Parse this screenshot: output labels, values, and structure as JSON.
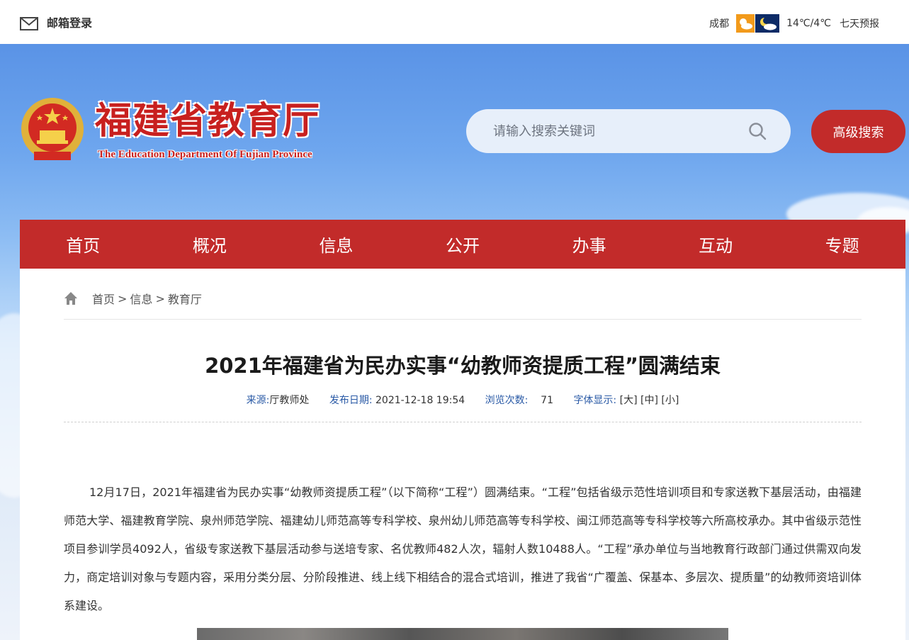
{
  "topbar": {
    "mail_label": "邮箱登录",
    "weather": {
      "city": "成都",
      "temp": "14℃/4℃",
      "forecast": "七天预报",
      "day_color": "#f29a1b",
      "night_color": "#0d2b66"
    }
  },
  "header": {
    "site_title": "福建省教育厅",
    "site_subtitle": "The Education Department Of Fujian Province",
    "search_placeholder": "请输入搜索关键词",
    "advanced_search_label": "高级搜索"
  },
  "nav": {
    "items": [
      "首页",
      "概况",
      "信息",
      "公开",
      "办事",
      "互动",
      "专题"
    ]
  },
  "breadcrumb": {
    "items": [
      "首页",
      "信息",
      "教育厅"
    ],
    "sep": ">"
  },
  "article": {
    "title": "2021年福建省为民办实事“幼教师资提质工程”圆满结束",
    "meta": {
      "source_label": "来源:",
      "source_value": "厅教师处",
      "date_label": "发布日期:",
      "date_value": "2021-12-18 19:54",
      "views_label": "浏览次数:",
      "views_value": "71",
      "font_label": "字体显示:",
      "font_large": "[大]",
      "font_medium": "[中]",
      "font_small": "[小]"
    },
    "body": "12月17日，2021年福建省为民办实事“幼教师资提质工程”（以下简称“工程”）圆满结束。“工程”包括省级示范性培训项目和专家送教下基层活动，由福建师范大学、福建教育学院、泉州师范学院、福建幼儿师范高等专科学校、泉州幼儿师范高等专科学校、闽江师范高等专科学校等六所高校承办。其中省级示范性项目参训学员4092人，省级专家送教下基层活动参与送培专家、名优教师482人次，辐射人数10488人。“工程”承办单位与当地教育行政部门通过供需双向发力，商定培训对象与专题内容，采用分类分层、分阶段推进、线上线下相结合的混合式培训，推进了我省“广覆盖、保基本、多层次、提质量”的幼教师资培训体系建设。"
  },
  "colors": {
    "brand_red": "#c22b2a",
    "meta_label": "#2a5aa6"
  }
}
